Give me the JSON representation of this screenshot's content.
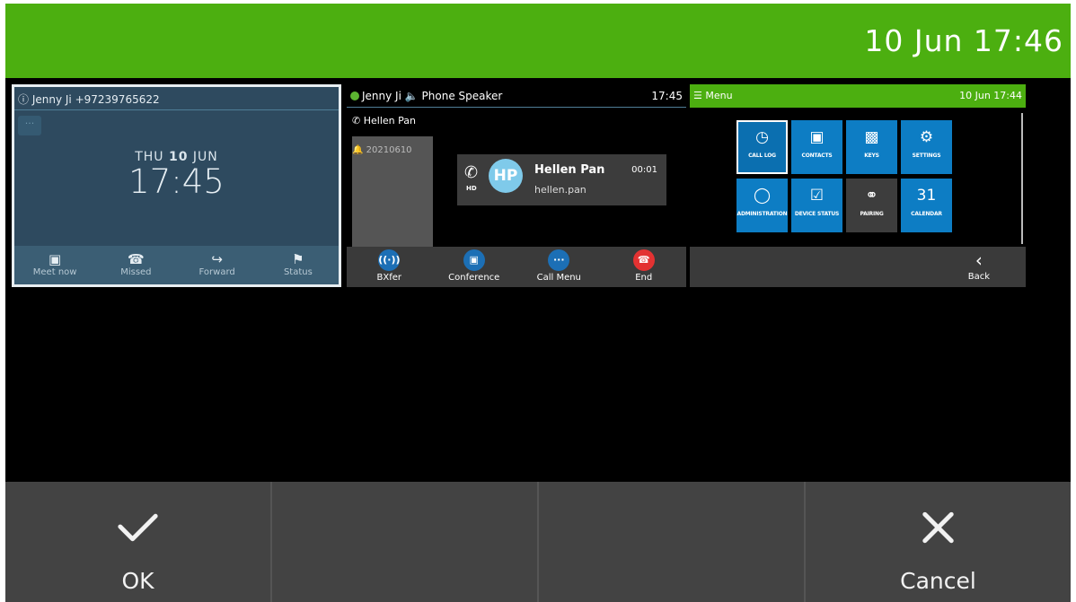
{
  "statusbar": {
    "clock": "10 Jun 17:46"
  },
  "thumbnails": {
    "idle": {
      "header": "Jenny Ji +97239765622",
      "dots": "···",
      "date_day": "THU",
      "date_num": "10",
      "date_month": "JUN",
      "time": "17:45",
      "softkeys": [
        "Meet now",
        "Missed",
        "Forward",
        "Status"
      ]
    },
    "call": {
      "header_name": "Jenny Ji",
      "header_audio": "Phone Speaker",
      "header_time": "17:45",
      "line_label": "Hellen Pan",
      "side_date": "20210610",
      "avatar_initials": "HP",
      "hd_badge": "HD",
      "contact_name": "Hellen Pan",
      "duration": "00:01",
      "username": "hellen.pan",
      "softkeys": [
        "BXfer",
        "Conference",
        "Call Menu",
        "End"
      ]
    },
    "menu": {
      "title": "Menu",
      "header_time": "10 Jun 17:44",
      "tiles": [
        {
          "label": "CALL LOG",
          "icon": "clock-icon"
        },
        {
          "label": "CONTACTS",
          "icon": "contacts-icon"
        },
        {
          "label": "KEYS",
          "icon": "keys-icon"
        },
        {
          "label": "SETTINGS",
          "icon": "gear-icon"
        },
        {
          "label": "ADMINISTRATION",
          "icon": "shield-icon"
        },
        {
          "label": "DEVICE STATUS",
          "icon": "device-status-icon"
        },
        {
          "label": "PAIRING",
          "icon": "pairing-icon"
        },
        {
          "label": "CALENDAR",
          "icon": "calendar-icon"
        }
      ],
      "calendar_day": "31",
      "back_label": "Back"
    }
  },
  "softkeys": {
    "ok_label": "OK",
    "cancel_label": "Cancel"
  },
  "colors": {
    "accent_green": "#4caf10",
    "tile_blue": "#0d7dc4",
    "end_red": "#e33232"
  }
}
